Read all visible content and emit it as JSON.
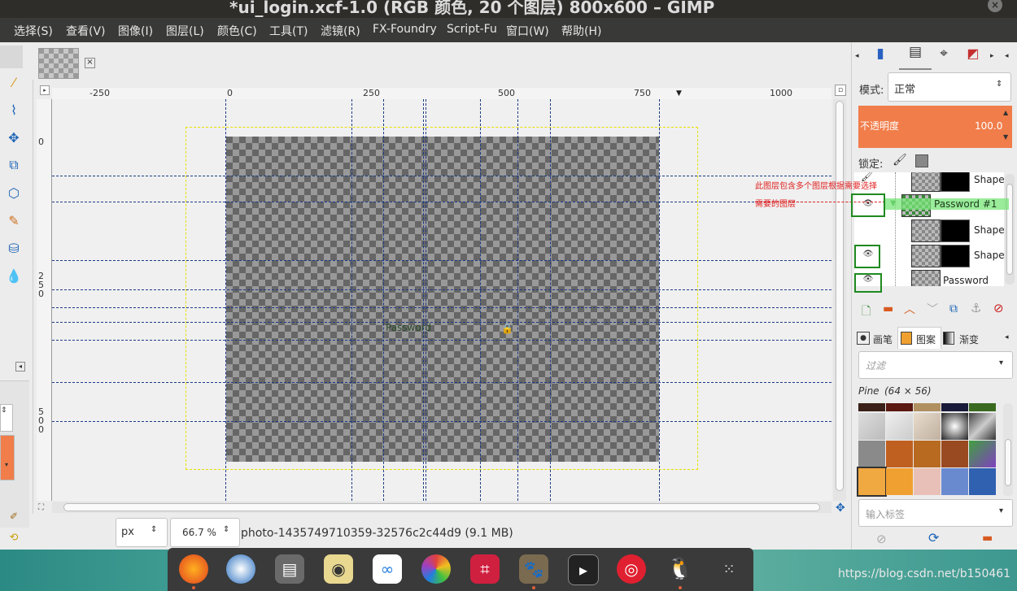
{
  "window": {
    "title": "*ui_login.xcf-1.0 (RGB 颜色, 20 个图层) 800x600 – GIMP",
    "close_glyph": "×"
  },
  "menubar": {
    "items": [
      "选择(S)",
      "查看(V)",
      "图像(I)",
      "图层(L)",
      "颜色(C)",
      "工具(T)",
      "滤镜(R)",
      "FX-Foundry",
      "Script-Fu",
      "窗口(W)",
      "帮助(H)"
    ]
  },
  "rulers": {
    "top_labels": [
      "-250",
      "0",
      "250",
      "500",
      "750",
      "1000"
    ],
    "left_labels": [
      "0",
      "250",
      "500"
    ]
  },
  "canvas": {
    "text_password": "Password"
  },
  "statusbar": {
    "unit": "px",
    "zoom": "66.7 %",
    "file_info": "photo-1435749710359-32576c2c44d9 (9.1 MB)"
  },
  "layers_panel": {
    "mode_label": "模式:",
    "mode_value": "正常",
    "opacity_label": "不透明度",
    "opacity_value": "100.0",
    "lock_label": "锁定:",
    "rows": [
      {
        "name": "Shape",
        "kind": "child"
      },
      {
        "name": "Password #1",
        "kind": "group"
      },
      {
        "name": "Shape",
        "kind": "child"
      },
      {
        "name": "Shape",
        "kind": "child"
      },
      {
        "name": "Password",
        "kind": "child"
      }
    ]
  },
  "annotation": {
    "line1": "此图层包含多个图层根据需要选择",
    "line2": "需要的图层"
  },
  "brushes_panel": {
    "tabs": [
      "画笔",
      "图案",
      "渐变"
    ],
    "filter_placeholder": "过滤",
    "pattern_name": "Pine",
    "pattern_size": "(64 × 56)",
    "tag_placeholder": "输入标签"
  },
  "taskbar": {
    "apps": [
      "firefox-icon",
      "thunderbird-icon",
      "file-manager-icon",
      "disk-icon",
      "baidu-netdisk-icon",
      "color-picker-icon",
      "screenshot-icon",
      "gimp-icon",
      "terminal-icon",
      "netease-music-icon",
      "qq-icon",
      "app-grid-icon"
    ]
  },
  "watermark": "https://blog.csdn.net/b150461",
  "colors": {
    "opacity_bar": "#f07d4a",
    "guide": "#1a3a8a",
    "annotation_text": "#e02020",
    "highlight": "#78e678"
  }
}
